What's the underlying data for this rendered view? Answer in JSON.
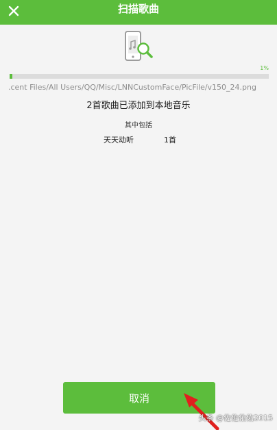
{
  "header": {
    "title": "扫描歌曲",
    "close_icon": "close-icon",
    "background": "#5cbd3c"
  },
  "scan": {
    "icon": "phone-music-search-icon",
    "progress_percent": 1,
    "progress_label": "1%",
    "current_path": ".cent Files/All Users/QQ/Misc/LNNCustomFace/PicFile/v150_24.png",
    "added_message": "2首歌曲已添加到本地音乐",
    "includes_label": "其中包括",
    "sources": [
      {
        "name": "天天动听",
        "count": "1首"
      }
    ]
  },
  "actions": {
    "cancel_label": "取消"
  },
  "overlay": {
    "arrow_icon": "red-arrow-icon",
    "arrow_color": "#e0201e",
    "watermark": "头条 @佐佐佑佑2015"
  },
  "colors": {
    "accent": "#5cbd3c",
    "background": "#f4f4f4"
  }
}
